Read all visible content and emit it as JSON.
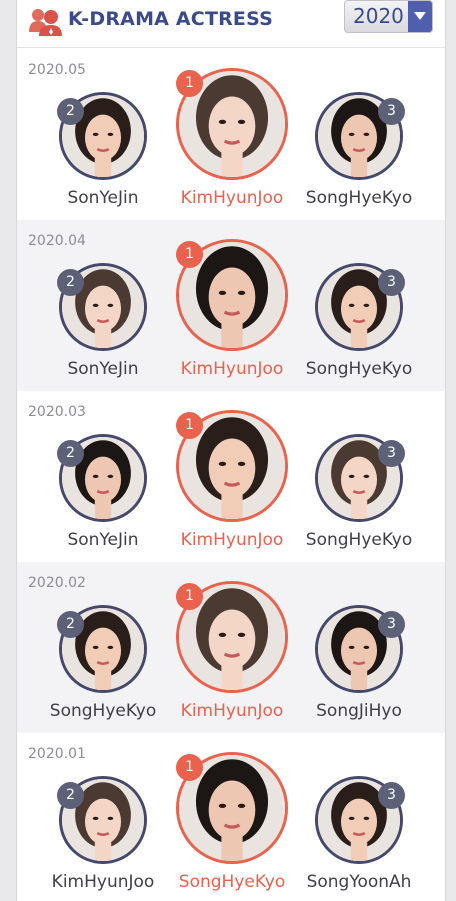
{
  "header": {
    "logo_icon": "people-user-icon",
    "title": "K-DRAMA ACTRESS",
    "year_selected": "2020",
    "dropdown_icon": "chevron-down-icon"
  },
  "colors": {
    "title": "#3a4a8a",
    "first_place": "#e8624e",
    "badge_gray": "#5c6178",
    "accent_blue": "#4f5fae"
  },
  "months": [
    {
      "date": "2020.05",
      "ranks": [
        {
          "rank": "2",
          "name": "SonYeJin"
        },
        {
          "rank": "1",
          "name": "KimHyunJoo"
        },
        {
          "rank": "3",
          "name": "SongHyeKyo"
        }
      ]
    },
    {
      "date": "2020.04",
      "ranks": [
        {
          "rank": "2",
          "name": "SonYeJin"
        },
        {
          "rank": "1",
          "name": "KimHyunJoo"
        },
        {
          "rank": "3",
          "name": "SongHyeKyo"
        }
      ]
    },
    {
      "date": "2020.03",
      "ranks": [
        {
          "rank": "2",
          "name": "SonYeJin"
        },
        {
          "rank": "1",
          "name": "KimHyunJoo"
        },
        {
          "rank": "3",
          "name": "SongHyeKyo"
        }
      ]
    },
    {
      "date": "2020.02",
      "ranks": [
        {
          "rank": "2",
          "name": "SongHyeKyo"
        },
        {
          "rank": "1",
          "name": "KimHyunJoo"
        },
        {
          "rank": "3",
          "name": "SongJiHyo"
        }
      ]
    },
    {
      "date": "2020.01",
      "ranks": [
        {
          "rank": "2",
          "name": "KimHyunJoo"
        },
        {
          "rank": "1",
          "name": "SongHyeKyo"
        },
        {
          "rank": "3",
          "name": "SongYoonAh"
        }
      ]
    }
  ]
}
